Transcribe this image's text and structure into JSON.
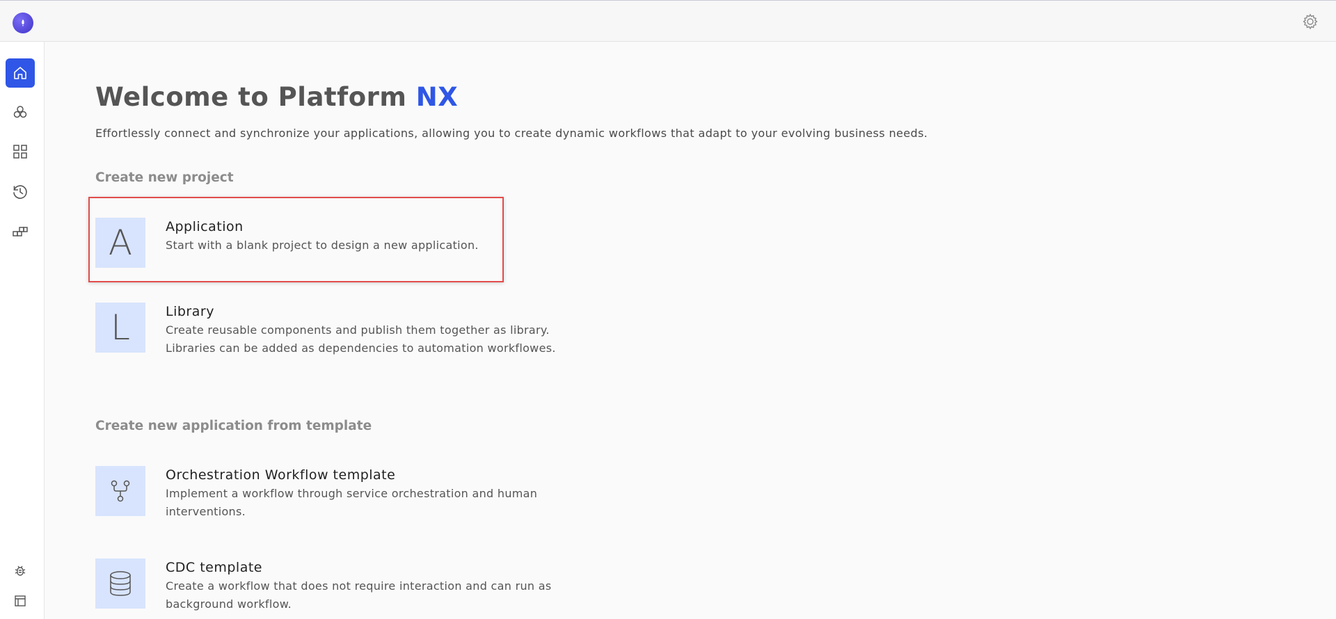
{
  "header": {
    "logo_icon": "rocket-icon",
    "settings_icon": "gear-icon"
  },
  "sidebar": {
    "items": [
      {
        "icon": "home-icon",
        "active": true
      },
      {
        "icon": "circles-cluster-icon",
        "active": false
      },
      {
        "icon": "grid-icon",
        "active": false
      },
      {
        "icon": "history-icon",
        "active": false
      },
      {
        "icon": "blocks-icon",
        "active": false
      }
    ],
    "bottom_items": [
      {
        "icon": "bug-icon"
      },
      {
        "icon": "layout-panel-icon"
      }
    ]
  },
  "main": {
    "title_prefix": "Welcome to Platform ",
    "title_accent": "NX",
    "subtitle": "Effortlessly connect and synchronize your applications, allowing you to create dynamic workflows that adapt to your evolving business needs.",
    "section_new_project": "Create new project",
    "section_template": "Create new application from template",
    "new_project_cards": [
      {
        "icon_letter": "A",
        "title": "Application",
        "description": "Start with a blank project to design a new application."
      },
      {
        "icon_letter": "L",
        "title": "Library",
        "description": "Create reusable components and publish them together as library. Libraries can be added as dependencies to automation workflowes."
      }
    ],
    "template_cards": [
      {
        "icon": "workflow-fork-icon",
        "title": "Orchestration Workflow template",
        "description": "Implement a workflow through service orchestration and human interventions."
      },
      {
        "icon": "database-icon",
        "title": "CDC template",
        "description": "Create a workflow that does not require interaction and can run as background workflow."
      }
    ]
  },
  "colors": {
    "accent": "#2f56e6",
    "card_icon_bg": "#d8e4fd",
    "highlight_border": "#e34c4c"
  }
}
